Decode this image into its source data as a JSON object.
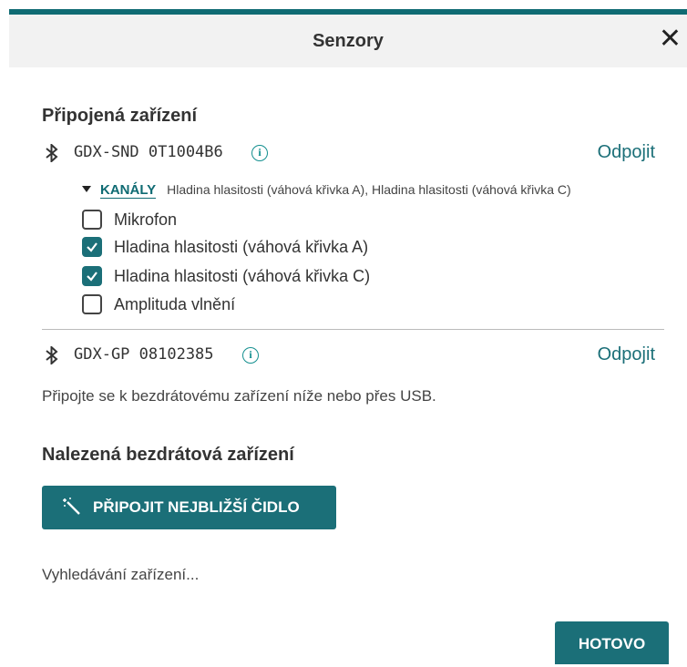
{
  "header": {
    "title": "Senzory",
    "close_label": "✕"
  },
  "connected": {
    "title": "Připojená zařízení",
    "devices": [
      {
        "name": "GDX-SND 0T1004B6",
        "disconnect_label": "Odpojit",
        "channels_label": "KANÁLY",
        "channels_summary": "Hladina hlasitosti (váhová křivka A), Hladina hlasitosti (váhová křivka C)",
        "channels": [
          {
            "label": "Mikrofon",
            "checked": false
          },
          {
            "label": "Hladina hlasitosti (váhová křivka A)",
            "checked": true
          },
          {
            "label": "Hladina hlasitosti (váhová křivka C)",
            "checked": true
          },
          {
            "label": "Amplituda vlnění",
            "checked": false
          }
        ]
      },
      {
        "name": "GDX-GP 08102385",
        "disconnect_label": "Odpojit"
      }
    ]
  },
  "hint": "Připojte se k bezdrátovému zařízení níže nebo přes USB.",
  "found": {
    "title": "Nalezená bezdrátová zařízení",
    "connect_nearest_label": "PŘIPOJIT NEJBLIŽŠÍ ČIDLO",
    "searching": "Vyhledávání zařízení..."
  },
  "footer": {
    "done_label": "HOTOVO"
  },
  "colors": {
    "accent": "#1b6f78",
    "topbar": "#0f6b73",
    "header_bg": "#f2f2f2"
  }
}
